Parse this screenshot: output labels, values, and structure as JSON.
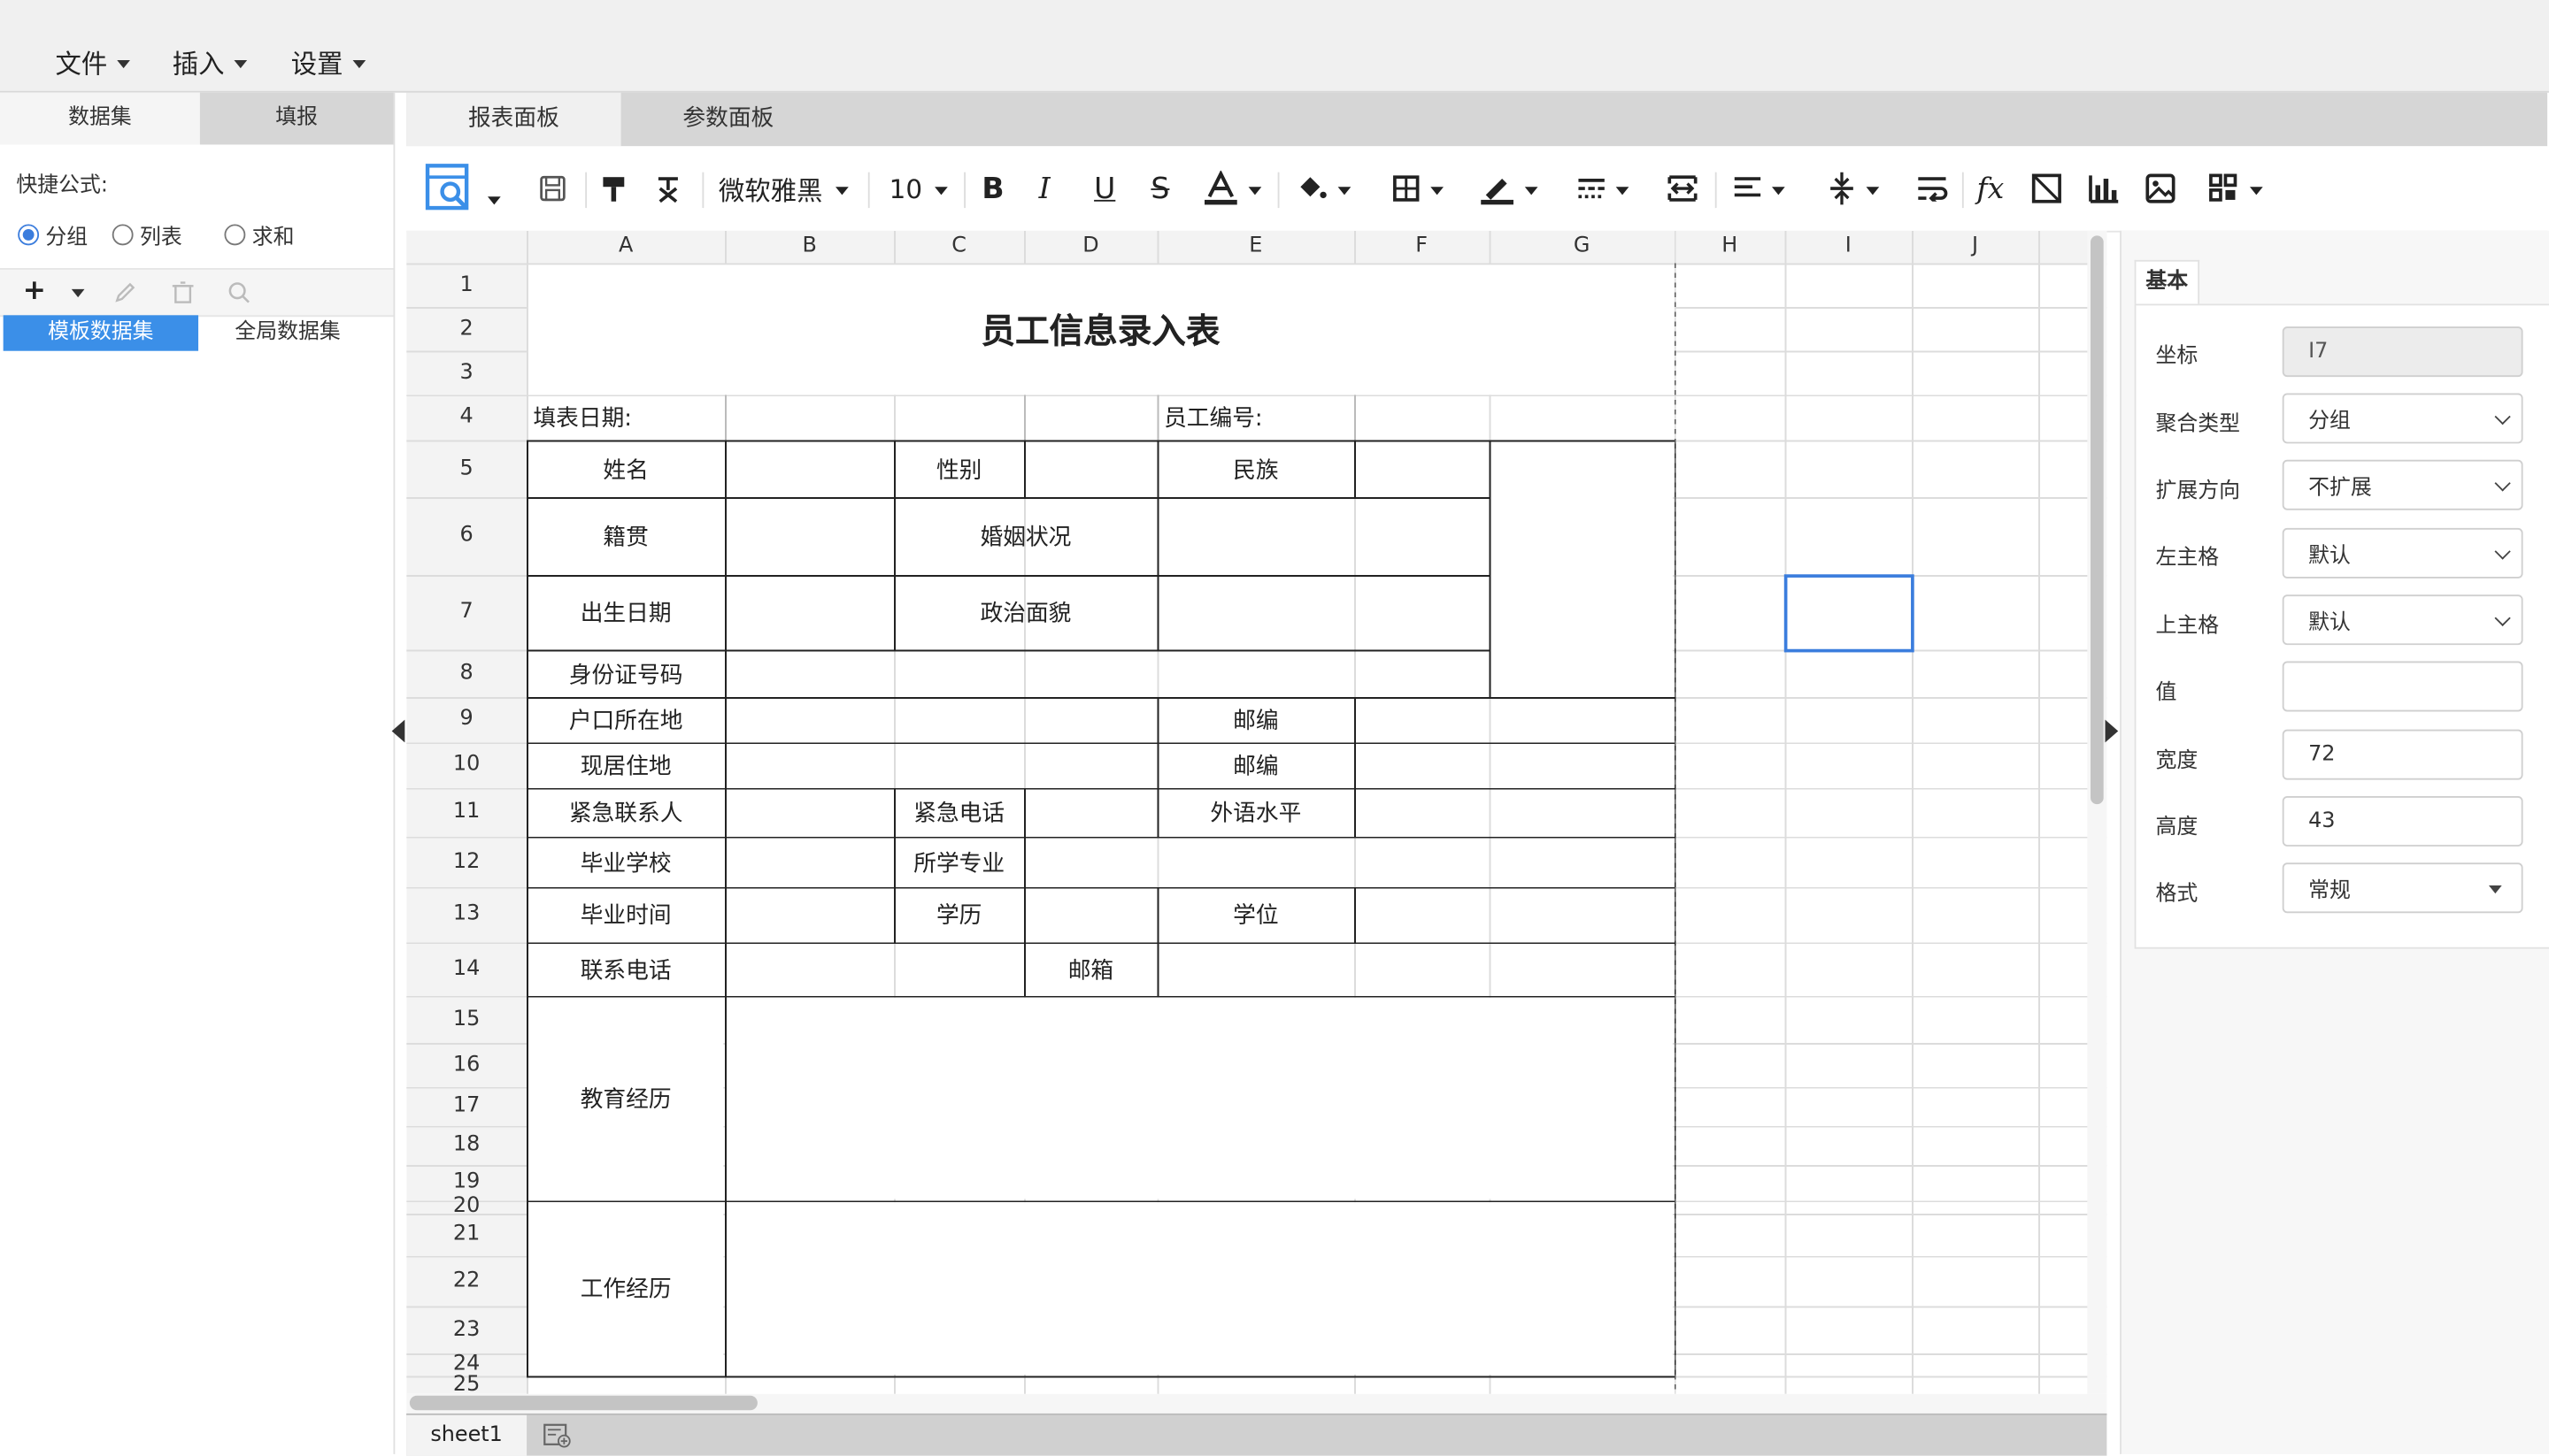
{
  "menubar": {
    "items": [
      "文件",
      "插入",
      "设置"
    ]
  },
  "left_panel": {
    "tabs": [
      "数据集",
      "填报"
    ],
    "quick_formula_label": "快捷公式:",
    "radios": [
      {
        "label": "分组",
        "checked": true
      },
      {
        "label": "列表",
        "checked": false
      },
      {
        "label": "求和",
        "checked": false
      }
    ],
    "dataset_tabs": [
      "模板数据集",
      "全局数据集"
    ]
  },
  "sheet_tabs": [
    "报表面板",
    "参数面板"
  ],
  "toolbar": {
    "font_name": "微软雅黑",
    "font_size": "10"
  },
  "grid": {
    "columns": [
      "A",
      "B",
      "C",
      "D",
      "E",
      "F",
      "G",
      "H",
      "I",
      "J"
    ],
    "rows": [
      "1",
      "2",
      "3",
      "4",
      "5",
      "6",
      "7",
      "8",
      "9",
      "10",
      "11",
      "12",
      "13",
      "14",
      "15",
      "16",
      "17",
      "18",
      "19",
      "20",
      "21",
      "22",
      "23",
      "24",
      "25"
    ],
    "cells": {
      "title": "员工信息录入表",
      "fill_date": "填表日期:",
      "employee_no": "员工编号:",
      "name": "姓名",
      "gender": "性别",
      "ethnicity": "民族",
      "native_place": "籍贯",
      "marital_status": "婚姻状况",
      "birth_date": "出生日期",
      "political_status": "政治面貌",
      "id_number": "身份证号码",
      "hukou": "户口所在地",
      "postcode1": "邮编",
      "current_address": "现居住地",
      "postcode2": "邮编",
      "emergency_contact": "紧急联系人",
      "emergency_phone": "紧急电话",
      "foreign_language": "外语水平",
      "school": "毕业学校",
      "major": "所学专业",
      "graduation_time": "毕业时间",
      "education": "学历",
      "degree": "学位",
      "phone": "联系电话",
      "email": "邮箱",
      "education_history": "教育经历",
      "work_history": "工作经历"
    }
  },
  "bottom": {
    "sheet_tab": "sheet1"
  },
  "properties": {
    "tab": "基本",
    "fields": [
      {
        "label": "坐标",
        "value": "I7"
      },
      {
        "label": "聚合类型",
        "value": "分组"
      },
      {
        "label": "扩展方向",
        "value": "不扩展"
      },
      {
        "label": "左主格",
        "value": "默认"
      },
      {
        "label": "上主格",
        "value": "默认"
      },
      {
        "label": "值",
        "value": ""
      },
      {
        "label": "宽度",
        "value": "72"
      },
      {
        "label": "高度",
        "value": "43"
      },
      {
        "label": "格式",
        "value": "常规"
      }
    ]
  },
  "colors": {
    "accent": "#3b8fe8",
    "selection": "#3b7ddd"
  },
  "icons": [
    "caret-down-icon",
    "preview-icon",
    "save-icon",
    "format-painter-icon",
    "clear-format-icon",
    "bold-icon",
    "italic-icon",
    "underline-icon",
    "strikethrough-icon",
    "font-color-icon",
    "fill-color-icon",
    "border-icon",
    "line-color-icon",
    "line-style-icon",
    "merge-cells-icon",
    "horizontal-align-icon",
    "vertical-align-icon",
    "wrap-text-icon",
    "function-icon",
    "slash-cell-icon",
    "chart-icon",
    "image-icon",
    "more-icon",
    "add-icon",
    "edit-icon",
    "delete-icon",
    "search-icon",
    "add-sheet-icon"
  ]
}
